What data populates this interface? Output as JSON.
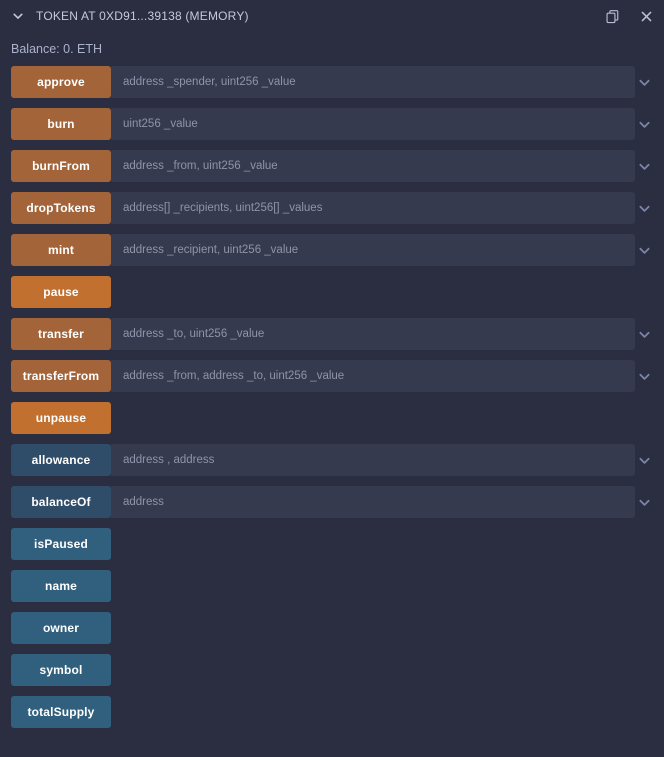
{
  "header": {
    "collapse_icon": "chevron-down-icon",
    "title": "TOKEN AT 0XD91...39138 (MEMORY)",
    "copy_icon": "copy-icon",
    "close_icon": "close-icon"
  },
  "balance": {
    "text": "Balance: 0. ETH"
  },
  "colors": {
    "background": "#2b2e40",
    "input_background": "#363a4f",
    "write_muted": "#a3643a",
    "write_bright": "#c2702f",
    "read_muted": "#2f4c68",
    "read_bright": "#31607f",
    "title_text": "#c3c9dd",
    "placeholder_text": "#8d94ab",
    "chevron": "#7b85a8"
  },
  "functions": [
    {
      "label": "approve",
      "kind": "write",
      "has_input": true,
      "placeholder": "address _spender, uint256 _value"
    },
    {
      "label": "burn",
      "kind": "write",
      "has_input": true,
      "placeholder": "uint256 _value"
    },
    {
      "label": "burnFrom",
      "kind": "write",
      "has_input": true,
      "placeholder": "address _from, uint256 _value"
    },
    {
      "label": "dropTokens",
      "kind": "write",
      "has_input": true,
      "placeholder": "address[] _recipients, uint256[] _values"
    },
    {
      "label": "mint",
      "kind": "write",
      "has_input": true,
      "placeholder": "address _recipient, uint256 _value"
    },
    {
      "label": "pause",
      "kind": "write",
      "has_input": false,
      "placeholder": ""
    },
    {
      "label": "transfer",
      "kind": "write",
      "has_input": true,
      "placeholder": "address _to, uint256 _value"
    },
    {
      "label": "transferFrom",
      "kind": "write",
      "has_input": true,
      "placeholder": "address _from, address _to, uint256 _value"
    },
    {
      "label": "unpause",
      "kind": "write",
      "has_input": false,
      "placeholder": ""
    },
    {
      "label": "allowance",
      "kind": "read",
      "has_input": true,
      "placeholder": "address , address"
    },
    {
      "label": "balanceOf",
      "kind": "read",
      "has_input": true,
      "placeholder": "address"
    },
    {
      "label": "isPaused",
      "kind": "read",
      "has_input": false,
      "placeholder": ""
    },
    {
      "label": "name",
      "kind": "read",
      "has_input": false,
      "placeholder": ""
    },
    {
      "label": "owner",
      "kind": "read",
      "has_input": false,
      "placeholder": ""
    },
    {
      "label": "symbol",
      "kind": "read",
      "has_input": false,
      "placeholder": ""
    },
    {
      "label": "totalSupply",
      "kind": "read",
      "has_input": false,
      "placeholder": ""
    }
  ]
}
